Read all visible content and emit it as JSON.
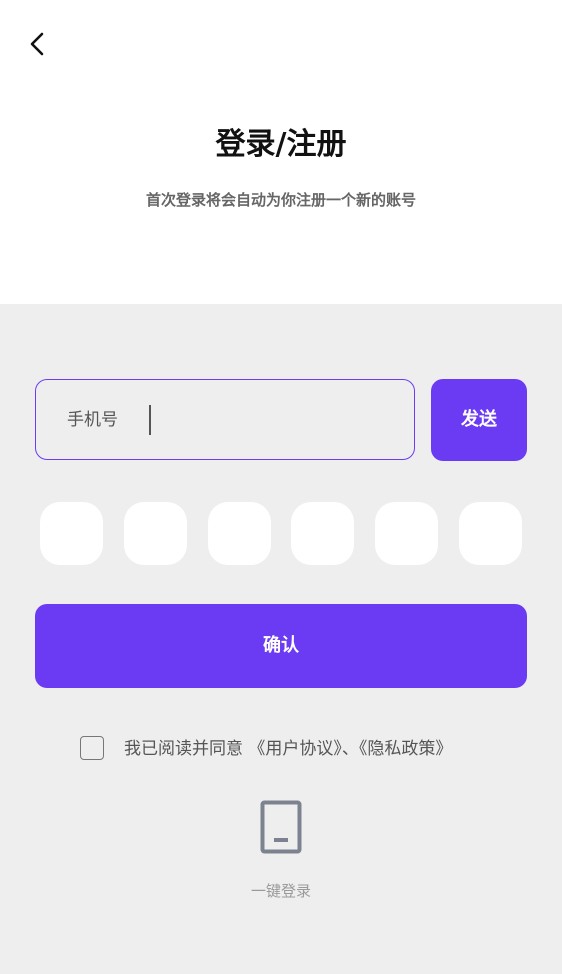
{
  "header": {
    "back_icon": "chevron-left-icon",
    "title": "登录/注册",
    "subtitle": "首次登录将会自动为你注册一个新的账号"
  },
  "form": {
    "phone_label": "手机号",
    "phone_value": "",
    "send_label": "发送",
    "code_boxes": [
      "",
      "",
      "",
      "",
      "",
      ""
    ],
    "confirm_label": "确认"
  },
  "agreement": {
    "checked": false,
    "prefix": "我已阅读并同意",
    "user_agreement": "《用户协议》",
    "separator": "、",
    "privacy_policy": "《隐私政策》"
  },
  "one_click": {
    "icon": "phone-icon",
    "label": "一键登录"
  },
  "colors": {
    "accent": "#6b3af3",
    "background_top": "#ffffff",
    "background_bottom": "#eeeeee"
  }
}
